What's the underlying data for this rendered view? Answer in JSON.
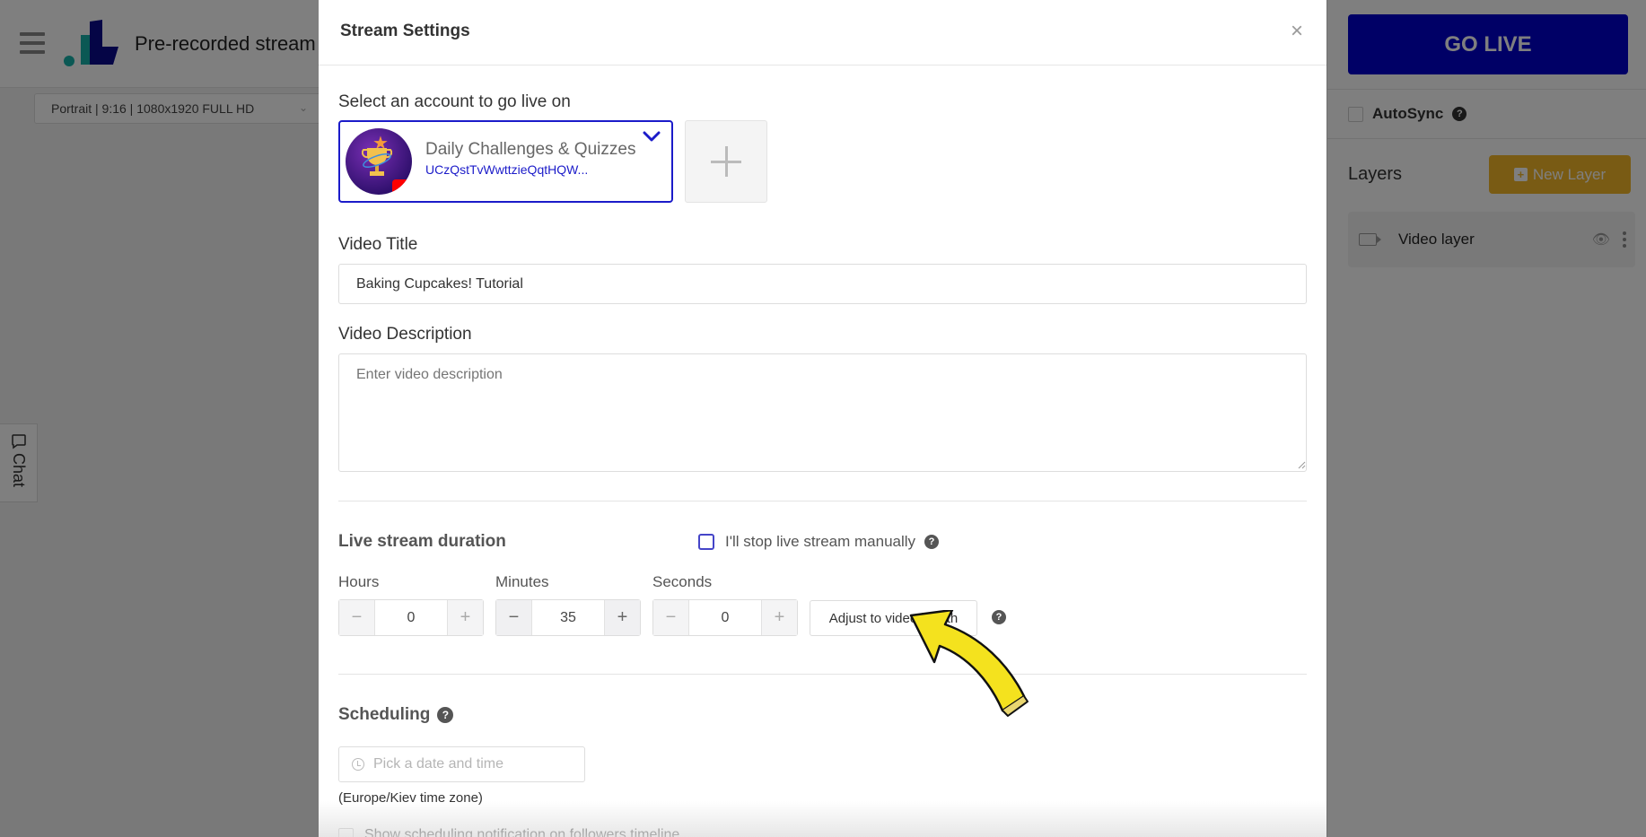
{
  "app": {
    "title": "Pre-recorded stream",
    "format_select": "Portrait | 9:16 | 1080x1920 FULL HD",
    "chat_tab_label": "Chat"
  },
  "right_panel": {
    "go_live_label": "GO LIVE",
    "autosync_label": "AutoSync",
    "autosync_checked": false,
    "layers_title": "Layers",
    "new_layer_label": "New Layer",
    "layers": [
      {
        "name": "Video layer",
        "icon": "video-camera-icon",
        "visible": true
      }
    ],
    "colors": {
      "go_live": "#0000cc",
      "new_layer": "#f3b728"
    }
  },
  "modal": {
    "title": "Stream Settings",
    "close_icon": "close-icon",
    "account_section_label": "Select an account to go live on",
    "selected_account": {
      "name": "Daily Challenges & Quizzes",
      "channel_id": "UCzQstTvWwttzieQqtHQW...",
      "platform": "YouTube",
      "selected": true
    },
    "add_account_icon": "plus-icon",
    "video_title_label": "Video Title",
    "video_title_value": "Baking Cupcakes! Tutorial",
    "video_description_label": "Video Description",
    "video_description_placeholder": "Enter video description",
    "video_description_value": "",
    "duration": {
      "title": "Live stream duration",
      "manual_stop_label": "I'll stop live stream manually",
      "manual_stop_checked": false,
      "hours_label": "Hours",
      "hours_value": "0",
      "minutes_label": "Minutes",
      "minutes_value": "35",
      "seconds_label": "Seconds",
      "seconds_value": "0",
      "minus_symbol": "−",
      "plus_symbol": "+",
      "adjust_button_label": "Adjust to video length"
    },
    "scheduling": {
      "title": "Scheduling",
      "date_placeholder": "Pick a date and time",
      "timezone_note": "(Europe/Kiev time zone)",
      "notification_label": "Show scheduling notification on followers timeline",
      "notification_checked": false
    },
    "help_symbol": "?",
    "accent_color": "#1b1bc9"
  }
}
